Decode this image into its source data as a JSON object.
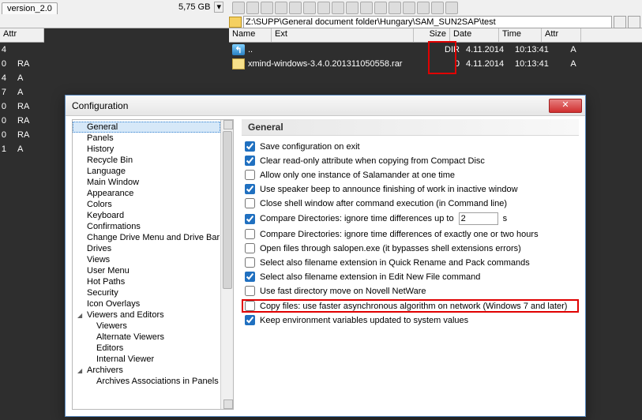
{
  "top": {
    "tab_label": "version_2.0",
    "size_label": "5,75 GB",
    "path": "Z:\\SUPP\\General document folder\\Hungary\\SAM_SUN2SAP\\test"
  },
  "left_panel": {
    "header_attr": "Attr",
    "rows": [
      {
        "n": "4",
        "attr": ""
      },
      {
        "n": "0",
        "attr": "RA"
      },
      {
        "n": "4",
        "attr": "A"
      },
      {
        "n": "7",
        "attr": "A"
      },
      {
        "n": "0",
        "attr": "RA"
      },
      {
        "n": "0",
        "attr": "RA"
      },
      {
        "n": "0",
        "attr": "RA"
      },
      {
        "n": "1",
        "attr": "A"
      }
    ]
  },
  "right_panel": {
    "headers": {
      "name": "Name",
      "ext": "Ext",
      "size": "Size",
      "date": "Date",
      "time": "Time",
      "attr": "Attr"
    },
    "rows": [
      {
        "name": "..",
        "ext": "",
        "size": "DIR",
        "date": "4.11.2014",
        "time": "10:13:41",
        "attr": "A",
        "icon": "up"
      },
      {
        "name": "xmind-windows-3.4.0.201311050558.rar",
        "ext": "",
        "size": "0",
        "date": "4.11.2014",
        "time": "10:13:41",
        "attr": "A",
        "icon": "zip"
      }
    ]
  },
  "dialog": {
    "title": "Configuration",
    "section_title": "General",
    "tree": [
      {
        "label": "General",
        "sel": true,
        "lvl": 0
      },
      {
        "label": "Panels",
        "lvl": 0
      },
      {
        "label": "History",
        "lvl": 0
      },
      {
        "label": "Recycle Bin",
        "lvl": 0
      },
      {
        "label": "Language",
        "lvl": 0
      },
      {
        "label": "Main Window",
        "lvl": 0
      },
      {
        "label": "Appearance",
        "lvl": 0
      },
      {
        "label": "Colors",
        "lvl": 0
      },
      {
        "label": "Keyboard",
        "lvl": 0
      },
      {
        "label": "Confirmations",
        "lvl": 0
      },
      {
        "label": "Change Drive Menu and Drive Bar",
        "lvl": 0
      },
      {
        "label": "Drives",
        "lvl": 0
      },
      {
        "label": "Views",
        "lvl": 0
      },
      {
        "label": "User Menu",
        "lvl": 0
      },
      {
        "label": "Hot Paths",
        "lvl": 0
      },
      {
        "label": "Security",
        "lvl": 0
      },
      {
        "label": "Icon Overlays",
        "lvl": 0
      },
      {
        "label": "Viewers and Editors",
        "lvl": 0,
        "exp": true
      },
      {
        "label": "Viewers",
        "lvl": 1
      },
      {
        "label": "Alternate Viewers",
        "lvl": 1
      },
      {
        "label": "Editors",
        "lvl": 1
      },
      {
        "label": "Internal Viewer",
        "lvl": 1
      },
      {
        "label": "Archivers",
        "lvl": 0,
        "exp": true
      },
      {
        "label": "Archives Associations in Panels",
        "lvl": 1
      }
    ],
    "opts": {
      "save_config": "Save configuration on exit",
      "clear_ro": "Clear read-only attribute when copying from Compact Disc",
      "one_instance": "Allow only one instance of Salamander at one time",
      "speaker_beep": "Use speaker beep to announce finishing of work in inactive window",
      "close_shell": "Close shell window after command execution (in Command line)",
      "cmp_dir_pre": "Compare Directories: ignore time differences up to",
      "cmp_dir_val": "2",
      "cmp_dir_post": "s",
      "cmp_dir_hours": "Compare Directories: ignore time differences of exactly one or two hours",
      "salopen": "Open files through salopen.exe (it bypasses shell extensions errors)",
      "sel_ext_qr": "Select also filename extension in Quick Rename and Pack commands",
      "sel_ext_new": "Select also filename extension in Edit New File command",
      "fast_novell": "Use fast directory move on Novell NetWare",
      "copy_async": "Copy files: use faster asynchronous algorithm on network (Windows 7 and later)",
      "keep_env": "Keep environment variables updated to system values"
    },
    "checked": {
      "save_config": true,
      "clear_ro": true,
      "one_instance": false,
      "speaker_beep": true,
      "close_shell": false,
      "cmp_dir": true,
      "cmp_dir_hours": false,
      "salopen": false,
      "sel_ext_qr": false,
      "sel_ext_new": true,
      "fast_novell": false,
      "copy_async": false,
      "keep_env": true
    }
  }
}
